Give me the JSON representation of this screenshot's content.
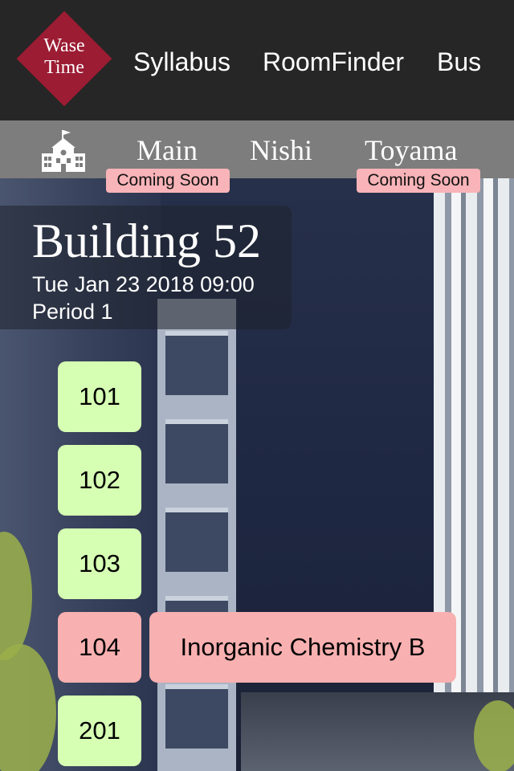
{
  "header": {
    "logo_line1": "Wase",
    "logo_line2": "Time",
    "nav": [
      "Syllabus",
      "RoomFinder",
      "Bus"
    ]
  },
  "campus": {
    "icon": "school-building-icon",
    "tabs": [
      {
        "label": "Main",
        "badge": "Coming Soon"
      },
      {
        "label": "Nishi",
        "badge": ""
      },
      {
        "label": "Toyama",
        "badge": "Coming Soon"
      }
    ]
  },
  "info": {
    "building": "Building 52",
    "datetime": "Tue Jan 23 2018 09:00",
    "period": "Period 1"
  },
  "rooms": [
    {
      "number": "101",
      "status": "free",
      "course": ""
    },
    {
      "number": "102",
      "status": "free",
      "course": ""
    },
    {
      "number": "103",
      "status": "free",
      "course": ""
    },
    {
      "number": "104",
      "status": "occupied",
      "course": "Inorganic Chemistry B"
    },
    {
      "number": "201",
      "status": "free",
      "course": ""
    }
  ],
  "colors": {
    "brand": "#9b1c33",
    "header_bg": "#262626",
    "campus_bar_bg": "#7d7d7d",
    "badge_bg": "#f8b4b8",
    "room_free": "#d6ffb4",
    "room_occupied": "#f9b0b0"
  }
}
